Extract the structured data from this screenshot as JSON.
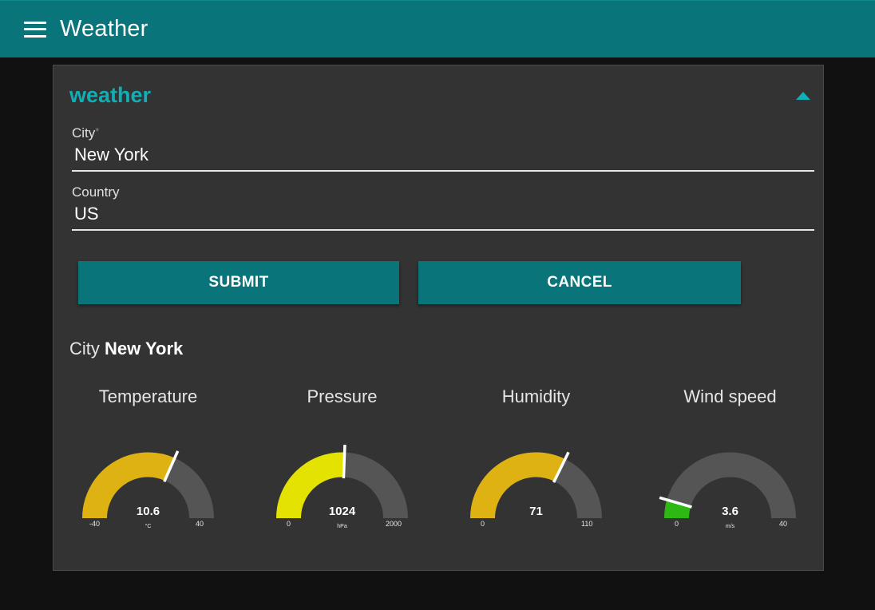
{
  "app": {
    "title": "Weather"
  },
  "form": {
    "group_title": "weather",
    "city_label": "City",
    "required_mark": "*",
    "city_value": "New York",
    "country_label": "Country",
    "country_value": "US",
    "submit_label": "SUBMIT",
    "cancel_label": "CANCEL"
  },
  "result": {
    "prefix": "City",
    "city": "New York"
  },
  "gauges": [
    {
      "title": "Temperature",
      "value": 10.6,
      "value_text": "10.6",
      "unit": "°C",
      "min": -40,
      "max": 40,
      "min_text": "-40",
      "max_text": "40",
      "color": "#ddb212"
    },
    {
      "title": "Pressure",
      "value": 1024,
      "value_text": "1024",
      "unit": "hPa",
      "min": 0,
      "max": 2000,
      "min_text": "0",
      "max_text": "2000",
      "color": "#e3e200"
    },
    {
      "title": "Humidity",
      "value": 71,
      "value_text": "71",
      "unit": "",
      "min": 0,
      "max": 110,
      "min_text": "0",
      "max_text": "110",
      "color": "#ddb212"
    },
    {
      "title": "Wind speed",
      "value": 3.6,
      "value_text": "3.6",
      "unit": "m/s",
      "min": 0,
      "max": 40,
      "min_text": "0",
      "max_text": "40",
      "color": "#2db813"
    }
  ],
  "colors": {
    "accent": "#097479",
    "title_accent": "#10aeb7",
    "gauge_track": "#555555",
    "needle": "#ffffff"
  }
}
